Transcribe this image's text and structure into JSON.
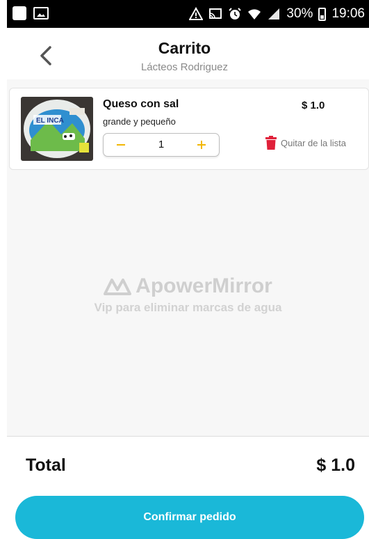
{
  "status_bar": {
    "battery": "30%",
    "time": "19:06",
    "icons": [
      "notification-square-icon",
      "gallery-icon",
      "warning-icon",
      "cast-icon",
      "alarm-icon",
      "wifi-icon",
      "signal-icon",
      "battery-icon"
    ]
  },
  "header": {
    "title": "Carrito",
    "subtitle": "Lácteos Rodriguez"
  },
  "cart": {
    "items": [
      {
        "name": "Queso con sal",
        "description": "grande y pequeño",
        "price": "$ 1.0",
        "quantity": "1",
        "remove_label": "Quitar de la lista",
        "image_label": "EL INCA"
      }
    ]
  },
  "watermark": {
    "brand": "ApowerMirror",
    "subtitle": "Vip para eliminar marcas de agua"
  },
  "summary": {
    "total_label": "Total",
    "total_value": "$ 1.0"
  },
  "actions": {
    "confirm_label": "Confirmar pedido"
  },
  "colors": {
    "accent": "#1ab8d8",
    "stepper": "#f2b705",
    "remove": "#e0213a"
  }
}
